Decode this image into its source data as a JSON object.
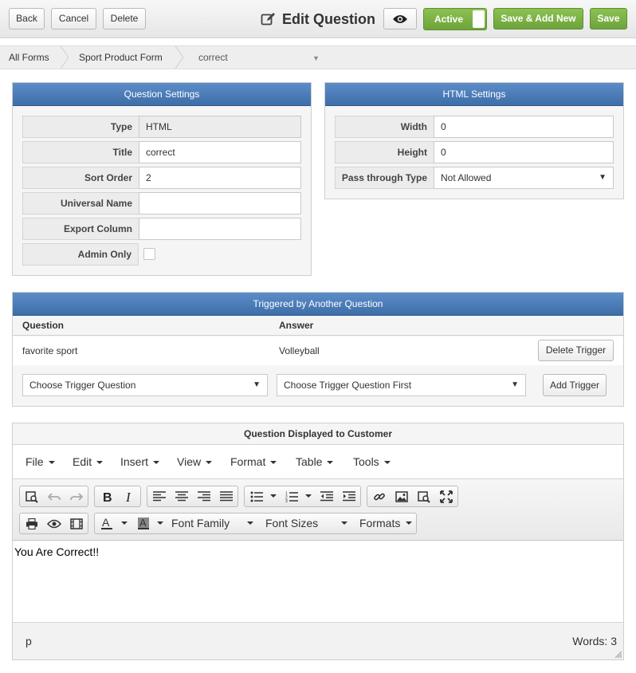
{
  "toolbar": {
    "back_label": "Back",
    "cancel_label": "Cancel",
    "delete_label": "Delete",
    "page_title": "Edit Question",
    "active_label": "Active",
    "save_add_new_label": "Save & Add New",
    "save_label": "Save"
  },
  "breadcrumb": {
    "items": [
      "All Forms",
      "Sport Product Form",
      "correct"
    ]
  },
  "question_settings": {
    "header": "Question Settings",
    "fields": [
      {
        "label": "Type",
        "value": "HTML"
      },
      {
        "label": "Title",
        "value": "correct"
      },
      {
        "label": "Sort Order",
        "value": "2"
      },
      {
        "label": "Universal Name",
        "value": ""
      },
      {
        "label": "Export Column",
        "value": ""
      },
      {
        "label": "Admin Only",
        "checked": false
      }
    ]
  },
  "html_settings": {
    "header": "HTML Settings",
    "fields": [
      {
        "label": "Width",
        "value": "0"
      },
      {
        "label": "Height",
        "value": "0"
      },
      {
        "label": "Pass through Type",
        "value": "Not Allowed"
      }
    ]
  },
  "triggers": {
    "header": "Triggered by Another Question",
    "columns": [
      "Question",
      "Answer"
    ],
    "rows": [
      {
        "question": "favorite sport",
        "answer": "Volleyball",
        "delete_label": "Delete Trigger"
      }
    ],
    "choose_question_placeholder": "Choose Trigger Question",
    "choose_answer_placeholder": "Choose Trigger Question First",
    "add_label": "Add Trigger"
  },
  "editor": {
    "header": "Question Displayed to Customer",
    "menus": [
      "File",
      "Edit",
      "Insert",
      "View",
      "Format",
      "Table",
      "Tools"
    ],
    "font_family_label": "Font Family",
    "font_sizes_label": "Font Sizes",
    "formats_label": "Formats",
    "content": "You Are Correct!!",
    "status_path": "p",
    "word_count": "Words: 3"
  },
  "colors": {
    "panel_header": "#4a7bb7",
    "accent_green": "#7cb342"
  }
}
